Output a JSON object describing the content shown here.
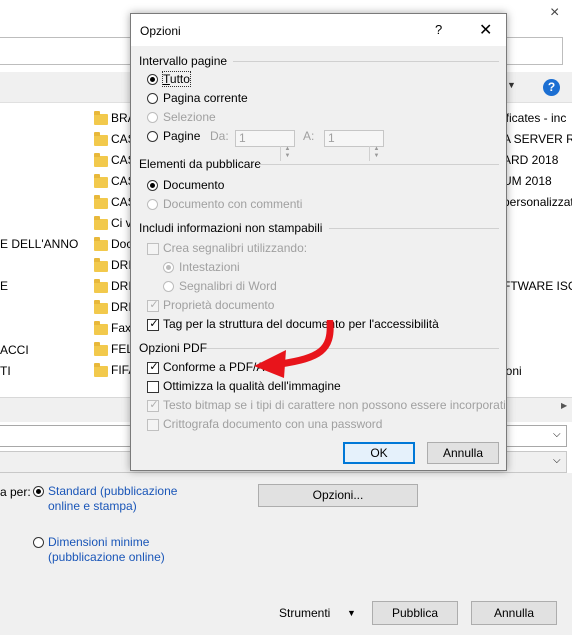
{
  "background": {
    "close_glyph": "×",
    "help_glyph": "?",
    "folders": [
      "BRA",
      "CAS",
      "CAS",
      "CAS",
      "CAS",
      "Ci v",
      "Doc",
      "DRII",
      "DRII",
      "DRII",
      "Fax",
      "FELI",
      "FIFA"
    ],
    "left_fragments": [
      {
        "text": "E DELL'ANNO"
      },
      {
        "text": "E"
      },
      {
        "text": "ACCI"
      },
      {
        "text": "TI"
      }
    ],
    "right_fragments": [
      {
        "text": "ificates - inc"
      },
      {
        "text": "A SERVER RIA"
      },
      {
        "text": "ARD 2018"
      },
      {
        "text": "UM 2018"
      },
      {
        "text": "personalizzat"
      },
      {
        "text": "FTWARE ISC"
      },
      {
        "text": "ioni"
      }
    ],
    "optimize_label": "a per:",
    "standard_option": "Standard (pubblicazione online e stampa)",
    "minimal_option": "Dimensioni minime (pubblicazione online)",
    "opzioni_button": "Opzioni...",
    "strumenti_label": "Strumenti",
    "pubblica_button": "Pubblica",
    "annulla_button": "Annulla"
  },
  "dialog": {
    "title": "Opzioni",
    "help_glyph": "?",
    "close_glyph": "✕",
    "page_range": {
      "heading": "Intervallo pagine",
      "all": "Tutto",
      "current": "Pagina corrente",
      "selection": "Selezione",
      "pages": "Pagine",
      "from_label": "Da:",
      "from_value": "1",
      "to_label": "A:",
      "to_value": "1"
    },
    "publish": {
      "heading": "Elementi da pubblicare",
      "document": "Documento",
      "document_comments": "Documento con commenti"
    },
    "nonprint": {
      "heading": "Includi informazioni non stampabili",
      "create_bookmarks": "Crea segnalibri utilizzando:",
      "headings": "Intestazioni",
      "word_bookmarks": "Segnalibri di Word",
      "doc_properties": "Proprietà documento",
      "structure_tags": "Tag per la struttura del documento per l'accessibilità"
    },
    "pdf": {
      "heading": "Opzioni PDF",
      "pdfa": "Conforme a PDF/A",
      "optimize_image": "Ottimizza la qualità dell'immagine",
      "bitmap_text": "Testo bitmap se i tipi di carattere non possono essere incorporati",
      "encrypt": "Crittografa documento con una password"
    },
    "ok_button": "OK",
    "cancel_button": "Annulla"
  },
  "colors": {
    "accent": "#0078d7",
    "annotation_arrow": "#e8141b",
    "link_blue": "#1a56b8"
  }
}
